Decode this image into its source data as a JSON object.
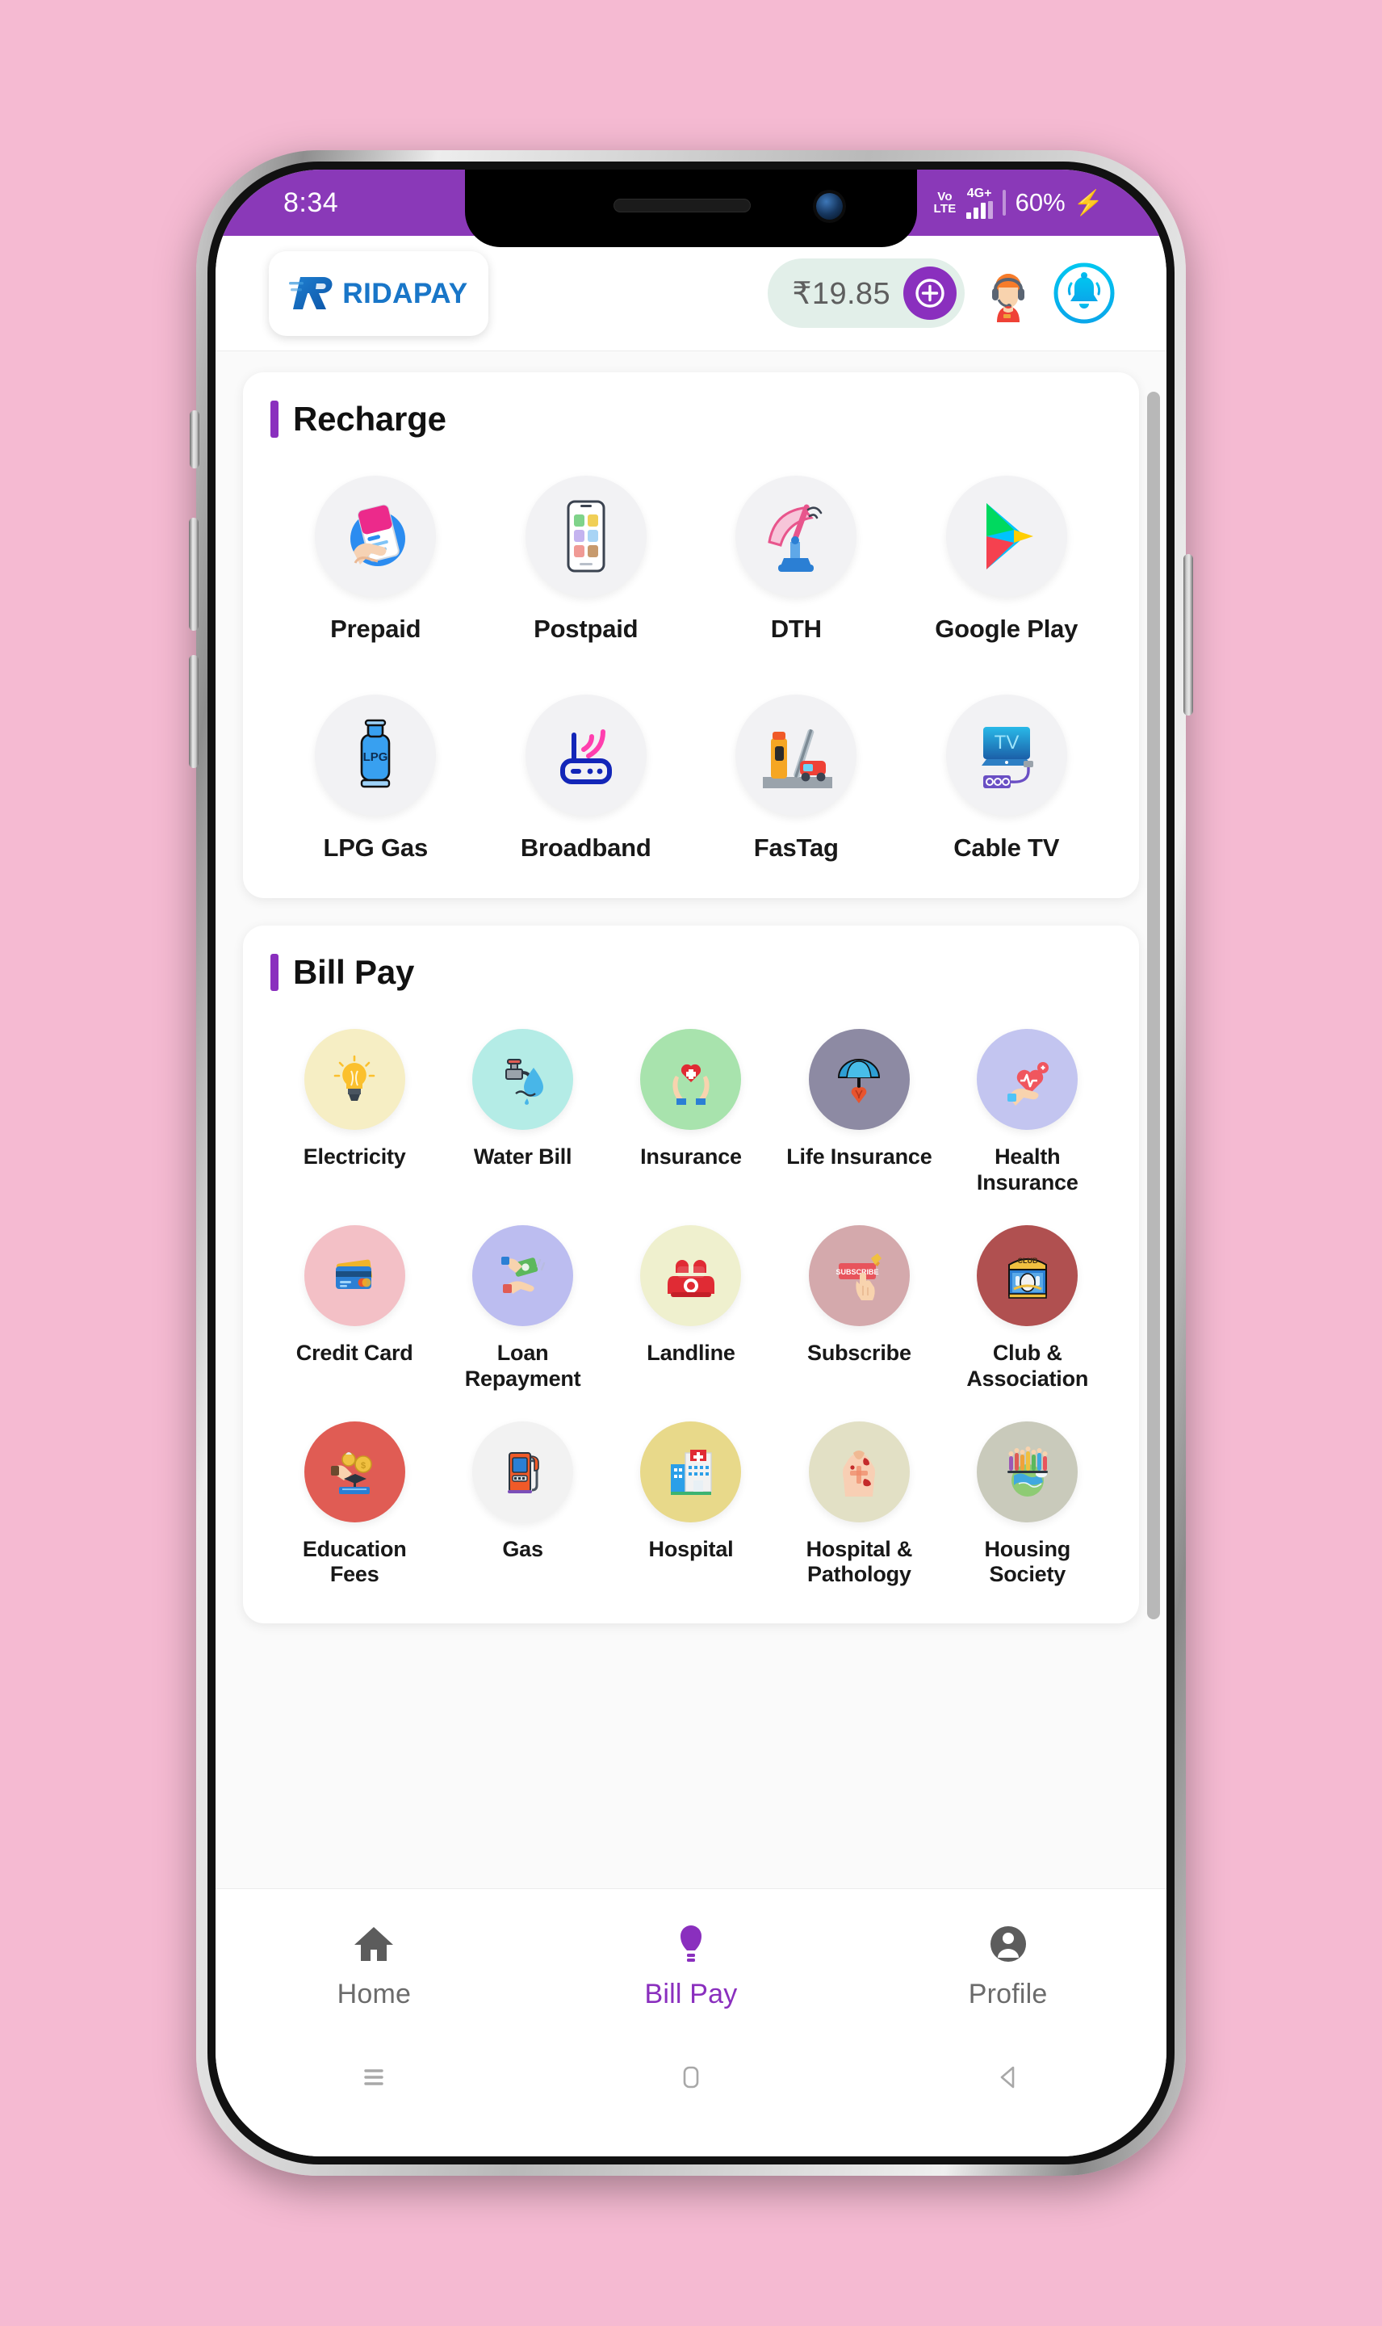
{
  "status_bar": {
    "time": "8:34",
    "volte": "VoLTE",
    "network": "4G+",
    "battery": "60%",
    "charging_icon": "bolt-icon"
  },
  "header": {
    "logo_text": "RIDAPAY",
    "balance": "₹19.85",
    "add_money_icon": "plus-circle-icon",
    "support_icon": "customer-support-icon",
    "notification_icon": "bell-icon"
  },
  "sections": [
    {
      "title": "Recharge",
      "items": [
        {
          "label": "Prepaid",
          "icon": "prepaid-mobile-icon",
          "bg": "#f2f2f4"
        },
        {
          "label": "Postpaid",
          "icon": "postpaid-phone-icon",
          "bg": "#f2f2f4"
        },
        {
          "label": "DTH",
          "icon": "satellite-dish-icon",
          "bg": "#f2f2f4"
        },
        {
          "label": "Google Play",
          "icon": "google-play-icon",
          "bg": "#f2f2f4"
        },
        {
          "label": "LPG Gas",
          "icon": "lpg-cylinder-icon",
          "bg": "#f2f2f4"
        },
        {
          "label": "Broadband",
          "icon": "router-icon",
          "bg": "#f2f2f4"
        },
        {
          "label": "FasTag",
          "icon": "toll-booth-icon",
          "bg": "#f2f2f4"
        },
        {
          "label": "Cable TV",
          "icon": "cable-tv-icon",
          "bg": "#f2f2f4"
        }
      ]
    },
    {
      "title": "Bill Pay",
      "items": [
        {
          "label": "Electricity",
          "icon": "lightbulb-icon",
          "bg": "#f6eec4"
        },
        {
          "label": "Water Bill",
          "icon": "water-tap-icon",
          "bg": "#b4ece6"
        },
        {
          "label": "Insurance",
          "icon": "heart-hands-icon",
          "bg": "#a8e3ad"
        },
        {
          "label": "Life Insurance",
          "icon": "umbrella-heart-icon",
          "bg": "#8d8aa3"
        },
        {
          "label": "Health\nInsurance",
          "icon": "health-heart-icon",
          "bg": "#c3c5f0"
        },
        {
          "label": "Credit Card",
          "icon": "credit-card-icon",
          "bg": "#f3c0c6"
        },
        {
          "label": "Loan\nRepayment",
          "icon": "money-hands-icon",
          "bg": "#bcbdf0"
        },
        {
          "label": "Landline",
          "icon": "landline-phone-icon",
          "bg": "#eff0ce"
        },
        {
          "label": "Subscribe",
          "icon": "subscribe-button-icon",
          "bg": "#d4a9ac"
        },
        {
          "label": "Club &\nAssociation",
          "icon": "club-building-icon",
          "bg": "#b05050"
        },
        {
          "label": "Education\nFees",
          "icon": "education-coins-icon",
          "bg": "#e05c54"
        },
        {
          "label": "Gas",
          "icon": "fuel-pump-icon",
          "bg": "#f2f2f2"
        },
        {
          "label": "Hospital",
          "icon": "hospital-icon",
          "bg": "#e8d98a"
        },
        {
          "label": "Hospital &\nPathology",
          "icon": "pathology-body-icon",
          "bg": "#e2e0c5"
        },
        {
          "label": "Housing\nSociety",
          "icon": "housing-society-icon",
          "bg": "#c9cabb"
        }
      ]
    }
  ],
  "bottom_nav": [
    {
      "label": "Home",
      "icon": "home-icon",
      "active": false
    },
    {
      "label": "Bill Pay",
      "icon": "bulb-icon",
      "active": true
    },
    {
      "label": "Profile",
      "icon": "person-icon",
      "active": false
    }
  ],
  "android_nav": [
    {
      "name": "recents-icon"
    },
    {
      "name": "home-square-icon"
    },
    {
      "name": "back-icon"
    }
  ],
  "colors": {
    "purple": "#8a39b8",
    "accent": "#8a2fbe",
    "page_bg": "#f5bad2",
    "balance_pill": "#e2efe9"
  }
}
